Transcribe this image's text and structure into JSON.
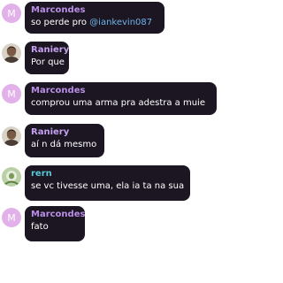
{
  "colors": {
    "bubble_bg": "#1c1622",
    "message_text": "#ffffff",
    "mention": "#6fb3ea",
    "letter_avatar_bg": "#e3b1e9"
  },
  "messages": [
    {
      "author": "Marcondes",
      "author_color": "#b98ee6",
      "avatar": {
        "type": "letter",
        "letter": "M",
        "icon": "letter-avatar"
      },
      "text": "so perde pro ",
      "mention": "@iankevin087"
    },
    {
      "author": "Raniery",
      "author_color": "#c3a1ef",
      "avatar": {
        "type": "photo",
        "icon": "user-photo-avatar"
      },
      "text": "Por que"
    },
    {
      "author": "Marcondes",
      "author_color": "#b98ee6",
      "avatar": {
        "type": "letter",
        "letter": "M",
        "icon": "letter-avatar"
      },
      "text": "comprou uma arma pra adestra a muie"
    },
    {
      "author": "Raniery",
      "author_color": "#c3a1ef",
      "avatar": {
        "type": "photo",
        "icon": "user-photo-avatar"
      },
      "text": "aí n dá mesmo"
    },
    {
      "author": "rern",
      "author_color": "#59c7d8",
      "avatar": {
        "type": "photo",
        "icon": "user-photo-avatar"
      },
      "text": "se vc tivesse uma, ela ia ta na sua"
    },
    {
      "author": "Marcondes",
      "author_color": "#b98ee6",
      "avatar": {
        "type": "letter",
        "letter": "M",
        "icon": "letter-avatar"
      },
      "text": "fato"
    }
  ]
}
